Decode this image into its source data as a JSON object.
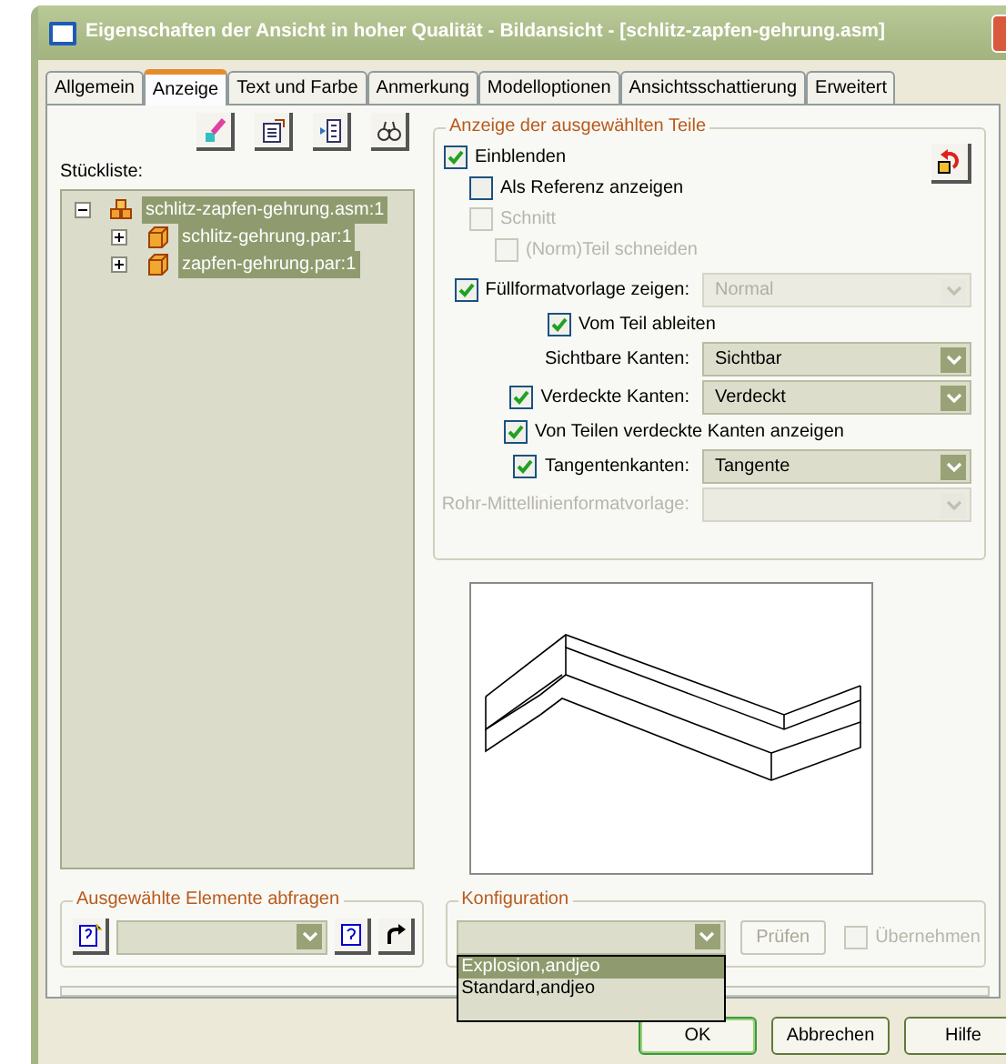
{
  "window": {
    "title": "Eigenschaften der Ansicht in hoher Qualität - Bildansicht - [schlitz-zapfen-gehrung.asm]"
  },
  "tabs": [
    {
      "label": "Allgemein",
      "selected": false
    },
    {
      "label": "Anzeige",
      "selected": true
    },
    {
      "label": "Text und Farbe",
      "selected": false
    },
    {
      "label": "Anmerkung",
      "selected": false
    },
    {
      "label": "Modelloptionen",
      "selected": false
    },
    {
      "label": "Ansichtsschattierung",
      "selected": false
    },
    {
      "label": "Erweitert",
      "selected": false
    }
  ],
  "parts_list": {
    "label": "Stückliste:",
    "tree": [
      {
        "label": "schlitz-zapfen-gehrung.asm:1",
        "kind": "assembly",
        "expanded": true,
        "selected": true,
        "children": [
          {
            "label": "schlitz-gehrung.par:1",
            "kind": "part",
            "expanded": false,
            "selected": true
          },
          {
            "label": "zapfen-gehrung.par:1",
            "kind": "part",
            "expanded": false,
            "selected": true
          }
        ]
      }
    ]
  },
  "display": {
    "title": "Anzeige der ausgewählten Teile",
    "options": [
      {
        "label": "Einblenden",
        "checked": true,
        "disabled": false,
        "children": [
          {
            "label": "Als Referenz anzeigen",
            "checked": false,
            "disabled": false
          },
          {
            "label": "Schnitt",
            "checked": false,
            "disabled": true,
            "children": [
              {
                "label": "(Norm)Teil schneiden",
                "checked": false,
                "disabled": true
              }
            ]
          }
        ]
      }
    ],
    "fields": [
      {
        "kind": "checkbox_select",
        "label": "Füllformatvorlage zeigen:",
        "checked": true,
        "value": "Normal",
        "disabled": true,
        "children": [
          {
            "label": "Vom Teil ableiten",
            "checked": true,
            "disabled": false
          }
        ]
      },
      {
        "kind": "select",
        "label": "Sichtbare Kanten:",
        "value": "Sichtbar",
        "disabled": false
      },
      {
        "kind": "checkbox_select",
        "label": "Verdeckte Kanten:",
        "checked": true,
        "value": "Verdeckt",
        "disabled": false
      },
      {
        "kind": "checkbox",
        "label": "Von Teilen verdeckte Kanten anzeigen",
        "checked": true,
        "disabled": false
      },
      {
        "kind": "checkbox_select",
        "label": "Tangentenkanten:",
        "checked": true,
        "value": "Tangente",
        "disabled": false
      },
      {
        "kind": "select",
        "label": "Rohr-Mittellinienformatvorlage:",
        "disabled": true
      }
    ]
  },
  "query": {
    "title": "Ausgewählte Elemente abfragen"
  },
  "configuration": {
    "title": "Konfiguration",
    "options": [
      {
        "label": "Explosion,andjeo",
        "selected": true
      },
      {
        "label": "Standard,andjeo",
        "selected": false
      }
    ],
    "check_button": {
      "label": "Prüfen",
      "disabled": true
    },
    "apply": {
      "label": "Übernehmen",
      "checked": false,
      "disabled": true
    }
  },
  "buttons": [
    {
      "label": "OK",
      "default": true
    },
    {
      "label": "Abbrechen",
      "default": false
    },
    {
      "label": "Hilfe",
      "default": false
    }
  ]
}
